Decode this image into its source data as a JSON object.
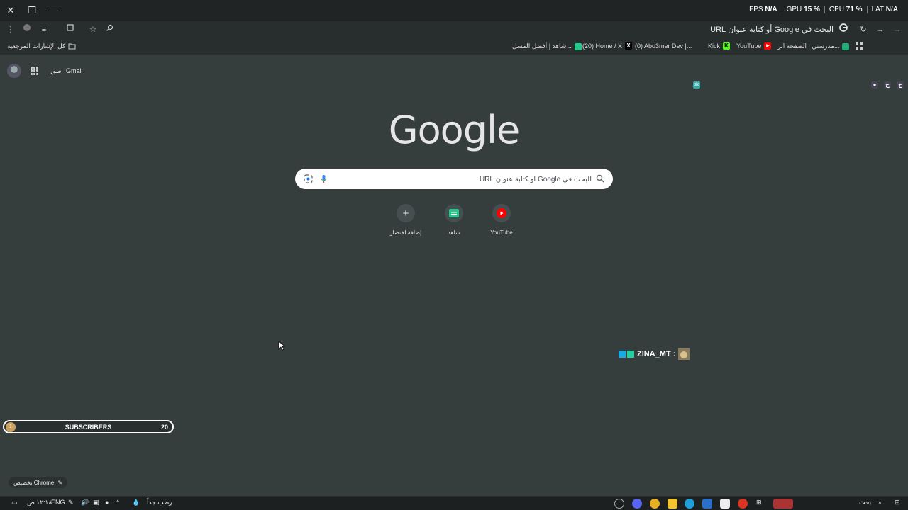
{
  "titlebar": {
    "stats": [
      {
        "label": "FPS",
        "value": "N/A"
      },
      {
        "label": "GPU",
        "value": "15 %"
      },
      {
        "label": "CPU",
        "value": "71 %"
      },
      {
        "label": "LAT",
        "value": "N/A"
      }
    ]
  },
  "toolbar": {
    "omnibox_text": "البحث في Google أو كتابة عنوان URL"
  },
  "bookmarks": {
    "all_bookmarks": "كل الإشارات المرجعية",
    "items": [
      "شاهد | أفضل المسل...",
      "(20) Home / X",
      "(0) Abo3mer Dev |...",
      "Kick",
      "YouTube",
      "مدرستي | الصفحة الر..."
    ]
  },
  "ntp": {
    "gmail": "Gmail",
    "images": "صور",
    "logo": "Google",
    "search_placeholder": "البحث في Google أو كتابة عنوان URL",
    "shortcuts": [
      {
        "label": "YouTube"
      },
      {
        "label": "شاهد"
      },
      {
        "label": "إضافة اختصار"
      }
    ],
    "customize": "تخصيص Chrome"
  },
  "overlay": {
    "chat_user": "ZINA_MT :",
    "subs_label": "SUBSCRIBERS",
    "subs_count": "20",
    "subs_coin": "1"
  },
  "taskbar": {
    "search": "بحث",
    "weather": "رطب جداً",
    "lang": "ENG",
    "time": "١٢:١٨ ص"
  },
  "colors": {
    "page_bg": "#353d3d",
    "toolbar_bg": "#282e2e",
    "youtube_red": "#ff0000",
    "shahid_green": "#22c98a",
    "kick_green": "#53fc18"
  }
}
